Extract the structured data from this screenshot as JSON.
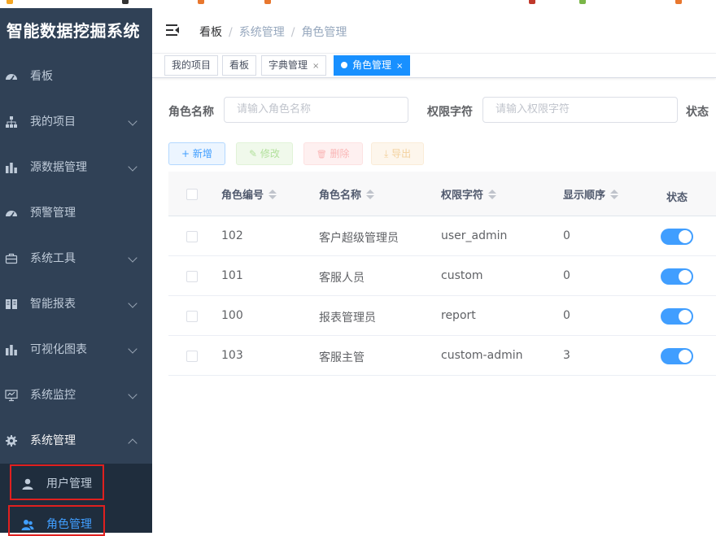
{
  "sidebar": {
    "title": "智能数据挖掘系统",
    "items": [
      {
        "label": "看板",
        "icon": "dashboard-icon",
        "chevron": false
      },
      {
        "label": "我的项目",
        "icon": "tree-icon",
        "chevron": true
      },
      {
        "label": "源数据管理",
        "icon": "chart-icon",
        "chevron": true
      },
      {
        "label": "预警管理",
        "icon": "dashboard-icon",
        "chevron": false
      },
      {
        "label": "系统工具",
        "icon": "toolbox-icon",
        "chevron": true
      },
      {
        "label": "智能报表",
        "icon": "book-icon",
        "chevron": true
      },
      {
        "label": "可视化图表",
        "icon": "chart-icon",
        "chevron": true
      },
      {
        "label": "系统监控",
        "icon": "monitor-icon",
        "chevron": true
      },
      {
        "label": "系统管理",
        "icon": "gear-icon",
        "chevron": "up"
      }
    ],
    "subitems": [
      {
        "label": "用户管理",
        "icon": "user-icon"
      },
      {
        "label": "角色管理",
        "icon": "peoples-icon"
      }
    ]
  },
  "navbar": {
    "breadcrumb": [
      "看板",
      "系统管理",
      "角色管理"
    ],
    "separator": "/"
  },
  "tags": [
    {
      "label": "我的项目",
      "closable": false
    },
    {
      "label": "看板",
      "closable": false
    },
    {
      "label": "字典管理",
      "closable": true
    },
    {
      "label": "角色管理",
      "closable": true,
      "active": true
    }
  ],
  "close_glyph": "×",
  "search": {
    "role_name_label": "角色名称",
    "role_name_placeholder": "请输入角色名称",
    "role_key_label": "权限字符",
    "role_key_placeholder": "请输入权限字符",
    "status_label": "状态"
  },
  "toolbar": {
    "add": "新增",
    "edit": "修改",
    "delete": "删除",
    "export": "导出",
    "add_icon": "+",
    "edit_icon": "✎",
    "delete_icon": "🗑",
    "export_icon": "⤓"
  },
  "table": {
    "columns": [
      "角色编号",
      "角色名称",
      "权限字符",
      "显示顺序",
      "状态"
    ],
    "rows": [
      {
        "id": "102",
        "name": "客户超级管理员",
        "key": "user_admin",
        "order": "0",
        "status": true
      },
      {
        "id": "101",
        "name": "客服人员",
        "key": "custom",
        "order": "0",
        "status": true
      },
      {
        "id": "100",
        "name": "报表管理员",
        "key": "report",
        "order": "0",
        "status": true
      },
      {
        "id": "103",
        "name": "客服主管",
        "key": "custom-admin",
        "order": "3",
        "status": true
      }
    ]
  },
  "colors": {
    "sidebar_bg": "#304156",
    "primary": "#409eff",
    "highlight_box": "#e0201f"
  }
}
